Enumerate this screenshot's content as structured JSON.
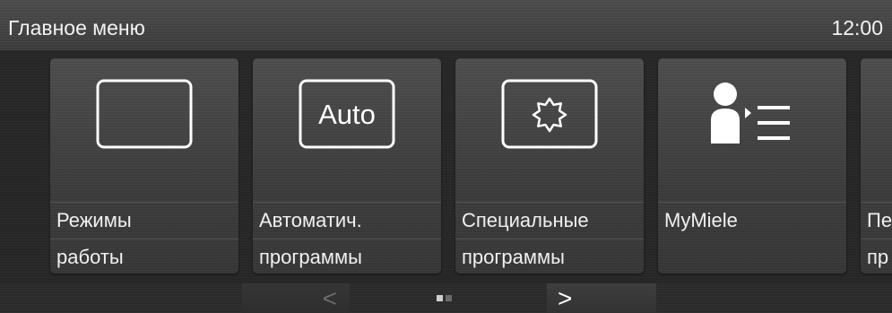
{
  "header": {
    "title": "Главное меню",
    "clock": "12:00"
  },
  "tiles": [
    {
      "icon": "blank-frame-icon",
      "label_line1": "Режимы",
      "label_line2": "работы"
    },
    {
      "icon": "auto-icon",
      "icon_text": "Auto",
      "label_line1": "Автоматич.",
      "label_line2": "программы"
    },
    {
      "icon": "special-star-icon",
      "label_line1": "Специальные",
      "label_line2": "программы"
    },
    {
      "icon": "user-list-icon",
      "label_line1": "MyMiele",
      "label_line2": ""
    },
    {
      "icon": "partial-tile",
      "label_line1": "Пе",
      "label_line2": "пр"
    }
  ],
  "footer": {
    "prev_label": "<",
    "next_label": ">",
    "pages_total": 2,
    "page_active": 1
  },
  "colors": {
    "background": "#262626",
    "tile": "#444444",
    "text": "#f0f0f0",
    "dot_active": "#cfcfcf",
    "dot_inactive": "#6b6b6b"
  }
}
